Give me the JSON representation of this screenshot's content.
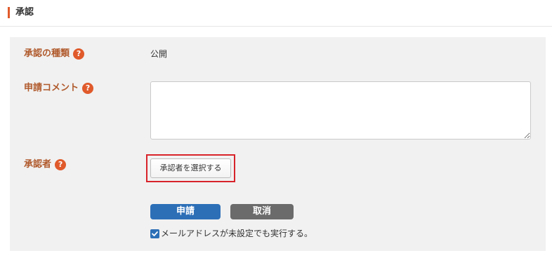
{
  "section": {
    "title": "承認"
  },
  "approval_type": {
    "label": "承認の種類",
    "value": "公開"
  },
  "comment": {
    "label": "申請コメント",
    "value": ""
  },
  "approver": {
    "label": "承認者",
    "select_button_label": "承認者を選択する"
  },
  "help_icon_glyph": "?",
  "actions": {
    "apply_label": "申請",
    "cancel_label": "取消"
  },
  "force_option": {
    "checked": true,
    "label": "メールアドレスが未設定でも実行する。"
  },
  "colors": {
    "accent": "#e05a2b",
    "label": "#b05a2c",
    "primary_button": "#2c6fb7",
    "secondary_button": "#6b6b6b",
    "highlight_border": "#d8232a",
    "panel_bg": "#f1f1f1"
  }
}
